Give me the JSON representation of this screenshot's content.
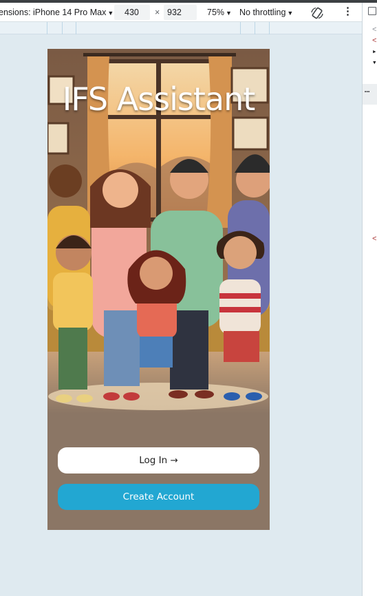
{
  "devtools_toolbar": {
    "device_label": "ensions: iPhone 14 Pro Max",
    "width_value": "430",
    "times_sign": "×",
    "height_value": "932",
    "zoom_label": "75%",
    "throttling_label": "No throttling"
  },
  "devtools_pane": {
    "line1": "<",
    "line2": "<",
    "line3": "▸",
    "line4": "▾",
    "more": "…",
    "line5": "<"
  },
  "app": {
    "title": "IFS Assistant",
    "login_label": "Log In →",
    "create_account_label": "Create Account",
    "brand_color": "#22a7d2",
    "background_color": "#8b7665"
  }
}
